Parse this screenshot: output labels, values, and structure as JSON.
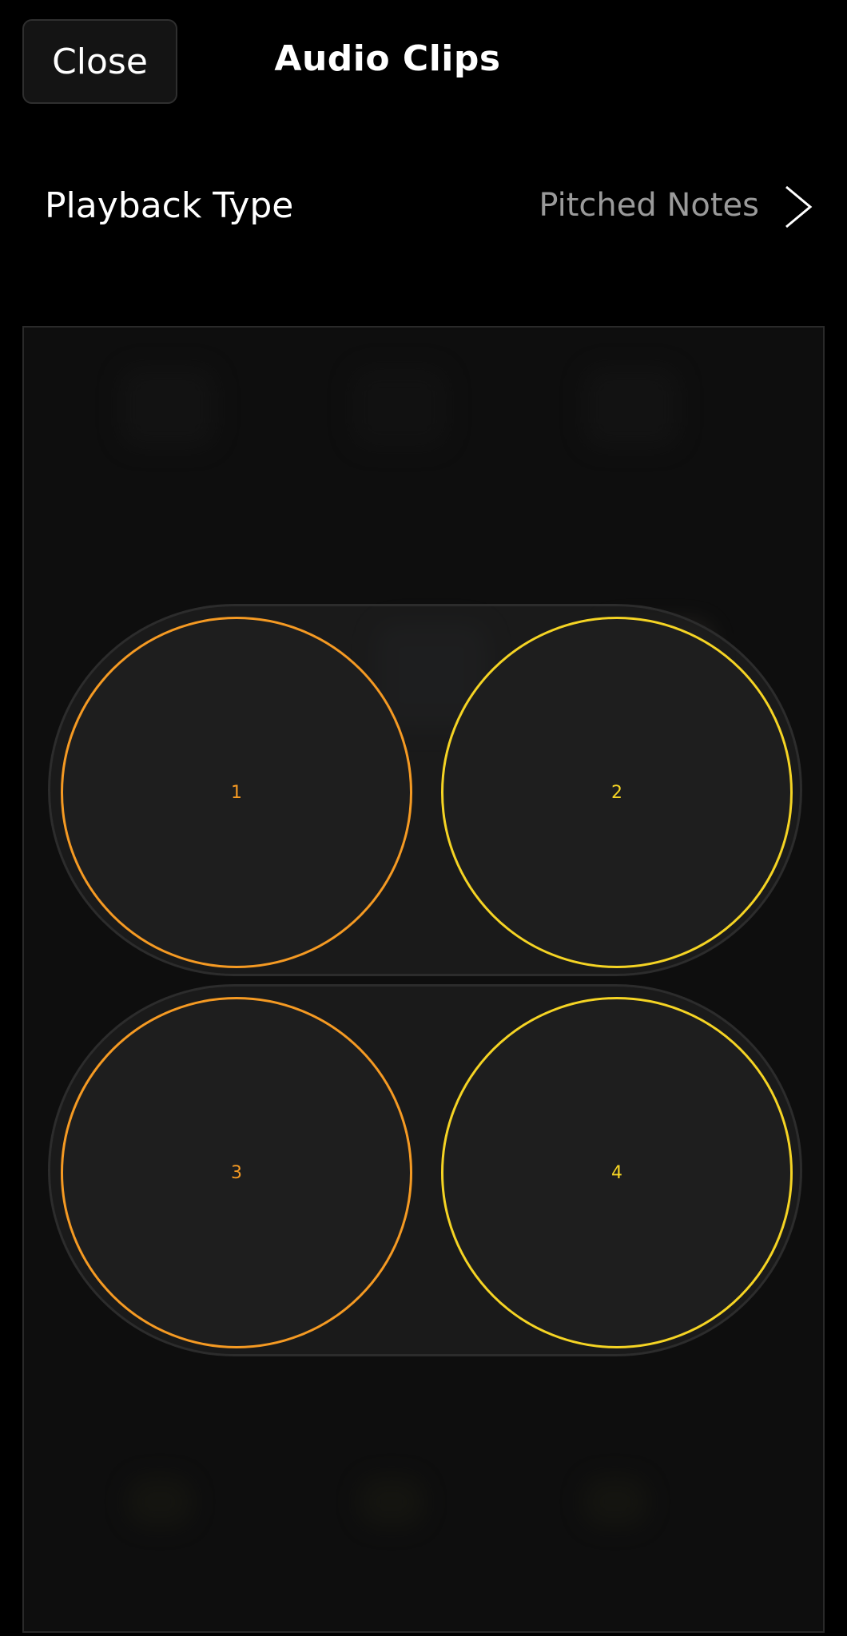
{
  "header": {
    "close_label": "Close",
    "title": "Audio Clips"
  },
  "playback": {
    "label": "Playback Type",
    "value": "Pitched Notes",
    "chevron_icon": "chevron-right-icon"
  },
  "pads": [
    {
      "label": "1",
      "color": "#f59a23"
    },
    {
      "label": "2",
      "color": "#f5d424"
    },
    {
      "label": "3",
      "color": "#f59a23"
    },
    {
      "label": "4",
      "color": "#f5d424"
    }
  ]
}
